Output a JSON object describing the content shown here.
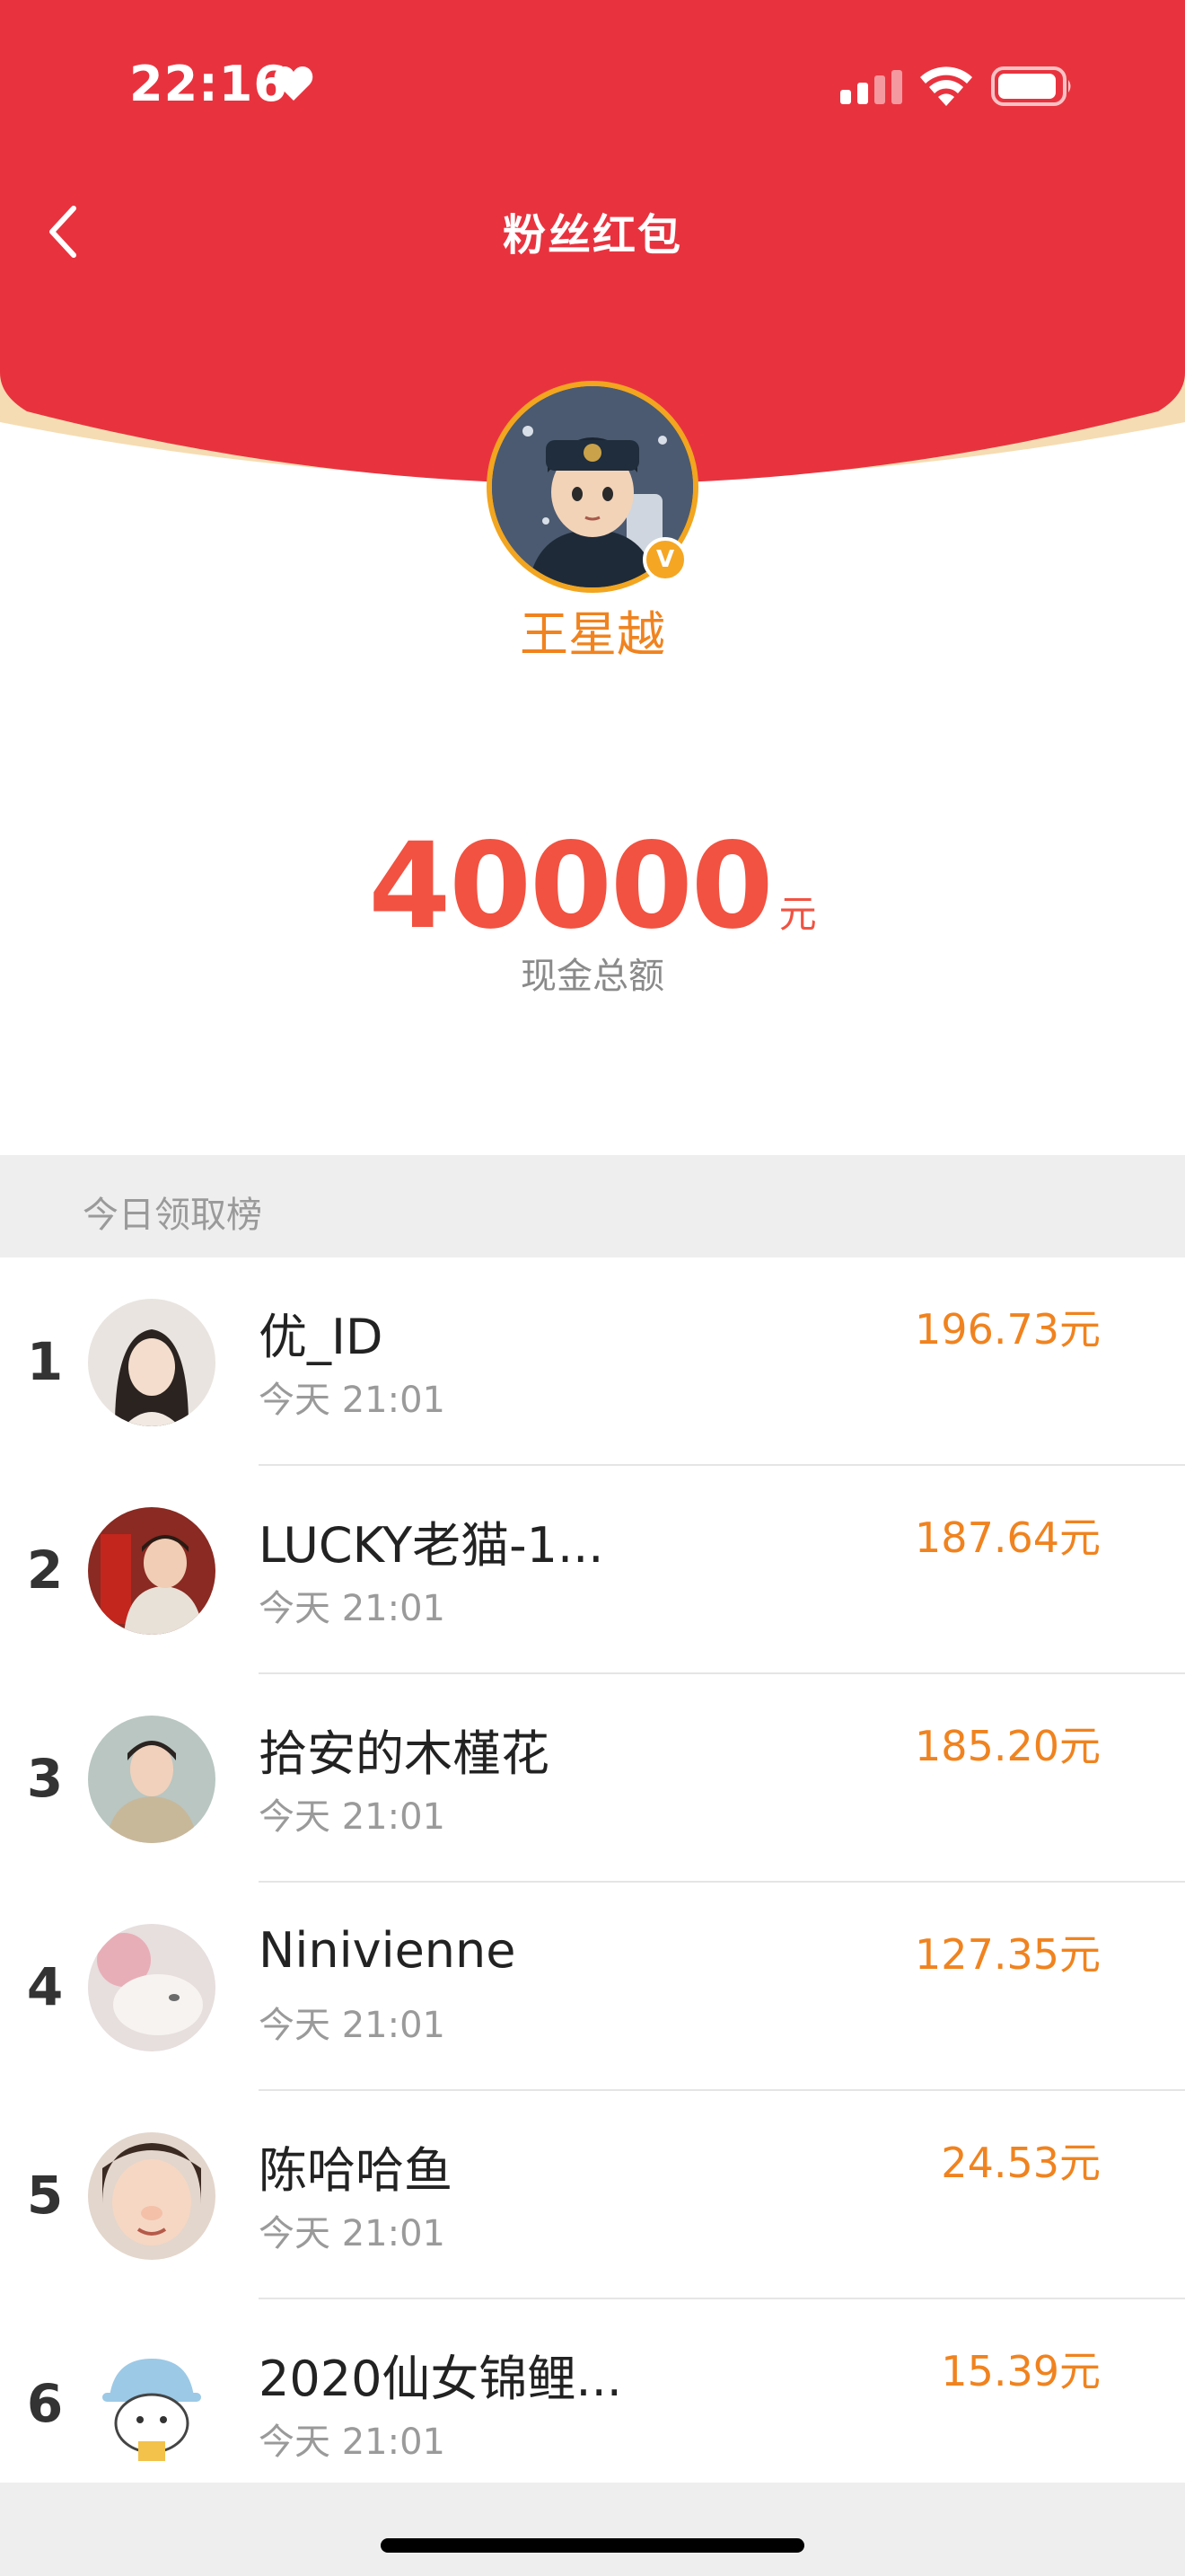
{
  "status_bar": {
    "time": "22:16"
  },
  "nav": {
    "title": "粉丝红包"
  },
  "host": {
    "name": "王星越",
    "badge": "V"
  },
  "total": {
    "amount": "40000",
    "unit": "元",
    "label": "现金总额"
  },
  "section": {
    "title": "今日领取榜"
  },
  "ranking": [
    {
      "rank": "1",
      "name": "优_ID",
      "time": "今天 21:01",
      "amount": "196.73元"
    },
    {
      "rank": "2",
      "name": "LUCKY老猫-1...",
      "time": "今天 21:01",
      "amount": "187.64元"
    },
    {
      "rank": "3",
      "name": "拾安的木槿花",
      "time": "今天 21:01",
      "amount": "185.20元"
    },
    {
      "rank": "4",
      "name": "Ninivienne",
      "time": "今天 21:01",
      "amount": "127.35元"
    },
    {
      "rank": "5",
      "name": "陈哈哈鱼",
      "time": "今天 21:01",
      "amount": "24.53元"
    },
    {
      "rank": "6",
      "name": "2020仙女锦鲤...",
      "time": "今天 21:01",
      "amount": "15.39元"
    }
  ],
  "colors": {
    "header_red": "#e8333f",
    "amount_red": "#f25241",
    "orange": "#f0831f"
  }
}
